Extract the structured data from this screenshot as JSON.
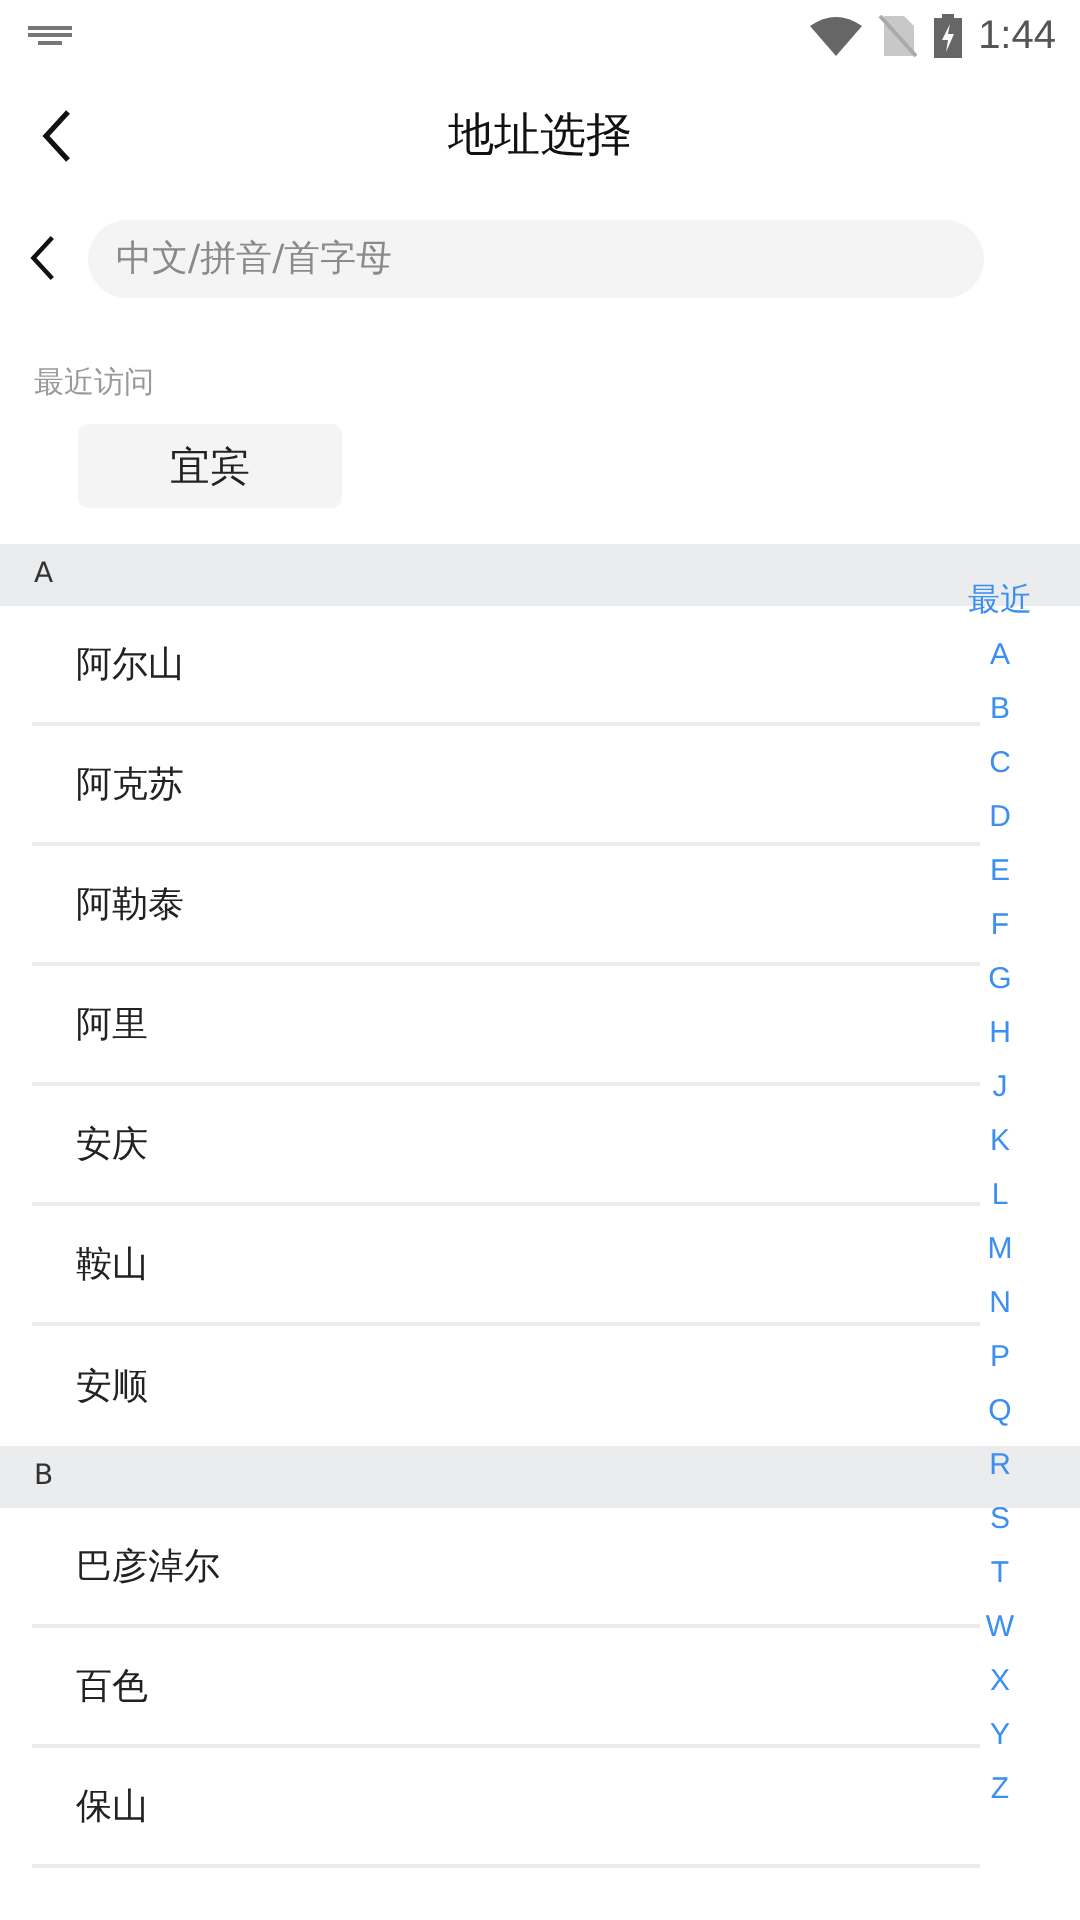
{
  "status_bar": {
    "time": "1:44"
  },
  "header": {
    "title": "地址选择"
  },
  "search": {
    "placeholder": "中文/拼音/首字母"
  },
  "recent": {
    "label": "最近访问",
    "cities": [
      "宜宾"
    ]
  },
  "sections": [
    {
      "letter": "A",
      "cities": [
        "阿尔山",
        "阿克苏",
        "阿勒泰",
        "阿里",
        "安庆",
        "鞍山",
        "安顺"
      ]
    },
    {
      "letter": "B",
      "cities": [
        "巴彦淖尔",
        "百色",
        "保山"
      ]
    }
  ],
  "index": [
    "最近",
    "A",
    "B",
    "C",
    "D",
    "E",
    "F",
    "G",
    "H",
    "J",
    "K",
    "L",
    "M",
    "N",
    "P",
    "Q",
    "R",
    "S",
    "T",
    "W",
    "X",
    "Y",
    "Z"
  ]
}
